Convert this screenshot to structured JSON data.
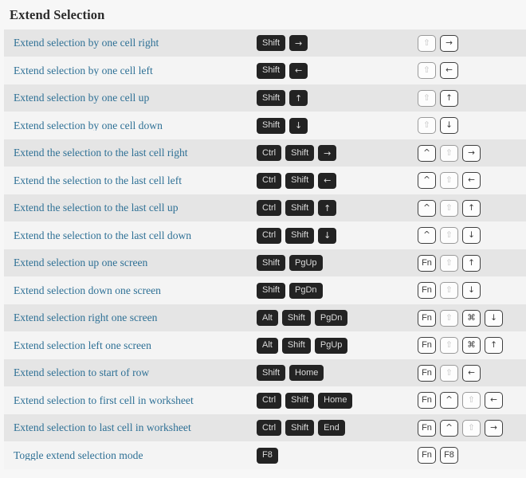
{
  "page": {
    "title": "Extend Selection",
    "colors": {
      "background": "#f7f7f7",
      "row_odd": "#f4f4f4",
      "row_even": "#e5e5e5",
      "link_text": "#2e7095",
      "win_key_bg": "#232323",
      "win_key_text": "#dcdcdc",
      "mac_key_bg": "#fdfdfd",
      "mac_key_border": "#3f3f3f",
      "mac_key_dim": "#c2c2c2"
    }
  },
  "rows": [
    {
      "description": "Extend selection by one cell right",
      "windows": [
        "Shift",
        "→"
      ],
      "mac": [
        "⇧",
        "→"
      ],
      "mac_dim": [
        true,
        false
      ]
    },
    {
      "description": "Extend selection by one cell left",
      "windows": [
        "Shift",
        "←"
      ],
      "mac": [
        "⇧",
        "←"
      ],
      "mac_dim": [
        true,
        false
      ]
    },
    {
      "description": "Extend selection by one cell up",
      "windows": [
        "Shift",
        "↑"
      ],
      "mac": [
        "⇧",
        "↑"
      ],
      "mac_dim": [
        true,
        false
      ]
    },
    {
      "description": "Extend selection by one cell down",
      "windows": [
        "Shift",
        "↓"
      ],
      "mac": [
        "⇧",
        "↓"
      ],
      "mac_dim": [
        true,
        false
      ]
    },
    {
      "description": "Extend the selection to the last cell right",
      "windows": [
        "Ctrl",
        "Shift",
        "→"
      ],
      "mac": [
        "^",
        "⇧",
        "→"
      ],
      "mac_dim": [
        false,
        true,
        false
      ]
    },
    {
      "description": "Extend the selection to the last cell left",
      "windows": [
        "Ctrl",
        "Shift",
        "←"
      ],
      "mac": [
        "^",
        "⇧",
        "←"
      ],
      "mac_dim": [
        false,
        true,
        false
      ]
    },
    {
      "description": "Extend the selection to the last cell up",
      "windows": [
        "Ctrl",
        "Shift",
        "↑"
      ],
      "mac": [
        "^",
        "⇧",
        "↑"
      ],
      "mac_dim": [
        false,
        true,
        false
      ]
    },
    {
      "description": "Extend the selection to the last cell down",
      "windows": [
        "Ctrl",
        "Shift",
        "↓"
      ],
      "mac": [
        "^",
        "⇧",
        "↓"
      ],
      "mac_dim": [
        false,
        true,
        false
      ]
    },
    {
      "description": "Extend selection up one screen",
      "windows": [
        "Shift",
        "PgUp"
      ],
      "mac": [
        "Fn",
        "⇧",
        "↑"
      ],
      "mac_dim": [
        false,
        true,
        false
      ]
    },
    {
      "description": "Extend selection down one screen",
      "windows": [
        "Shift",
        "PgDn"
      ],
      "mac": [
        "Fn",
        "⇧",
        "↓"
      ],
      "mac_dim": [
        false,
        true,
        false
      ]
    },
    {
      "description": "Extend selection right one screen",
      "windows": [
        "Alt",
        "Shift",
        "PgDn"
      ],
      "mac": [
        "Fn",
        "⇧",
        "⌘",
        "↓"
      ],
      "mac_dim": [
        false,
        true,
        false,
        false
      ]
    },
    {
      "description": "Extend selection left one screen",
      "windows": [
        "Alt",
        "Shift",
        "PgUp"
      ],
      "mac": [
        "Fn",
        "⇧",
        "⌘",
        "↑"
      ],
      "mac_dim": [
        false,
        true,
        false,
        false
      ]
    },
    {
      "description": "Extend selection to start of row",
      "windows": [
        "Shift",
        "Home"
      ],
      "mac": [
        "Fn",
        "⇧",
        "←"
      ],
      "mac_dim": [
        false,
        true,
        false
      ]
    },
    {
      "description": "Extend selection to first cell in worksheet",
      "windows": [
        "Ctrl",
        "Shift",
        "Home"
      ],
      "mac": [
        "Fn",
        "^",
        "⇧",
        "←"
      ],
      "mac_dim": [
        false,
        false,
        true,
        false
      ]
    },
    {
      "description": "Extend selection to last cell in worksheet",
      "windows": [
        "Ctrl",
        "Shift",
        "End"
      ],
      "mac": [
        "Fn",
        "^",
        "⇧",
        "→"
      ],
      "mac_dim": [
        false,
        false,
        true,
        false
      ]
    },
    {
      "description": "Toggle extend selection mode",
      "windows": [
        "F8"
      ],
      "mac": [
        "Fn",
        "F8"
      ],
      "mac_dim": [
        false,
        false
      ]
    }
  ]
}
